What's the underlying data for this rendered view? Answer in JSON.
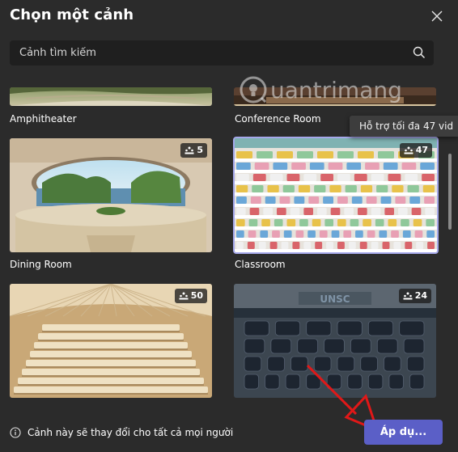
{
  "dialog": {
    "title": "Chọn một cảnh"
  },
  "search": {
    "placeholder": "Cảnh tìm kiếm"
  },
  "scenes": [
    {
      "label": "Amphitheater"
    },
    {
      "label": "Conference Room"
    },
    {
      "label": "Dining Room",
      "capacity": "5"
    },
    {
      "label": "Classroom",
      "capacity": "47",
      "selected": true
    },
    {
      "label": "",
      "capacity": "50"
    },
    {
      "label": "",
      "capacity": "24",
      "sign_text": "UNSC"
    }
  ],
  "tooltip": {
    "text": "Hỗ trợ tối đa 47 vid"
  },
  "watermark": {
    "text": "uantrimang"
  },
  "footer": {
    "info_text": "Cảnh này sẽ thay đổi cho tất cả mọi người",
    "apply_label": "Áp dụ..."
  },
  "colors": {
    "accent": "#5b5fc7",
    "selected_border": "#a5a8ea",
    "background": "#2b2b2b"
  }
}
